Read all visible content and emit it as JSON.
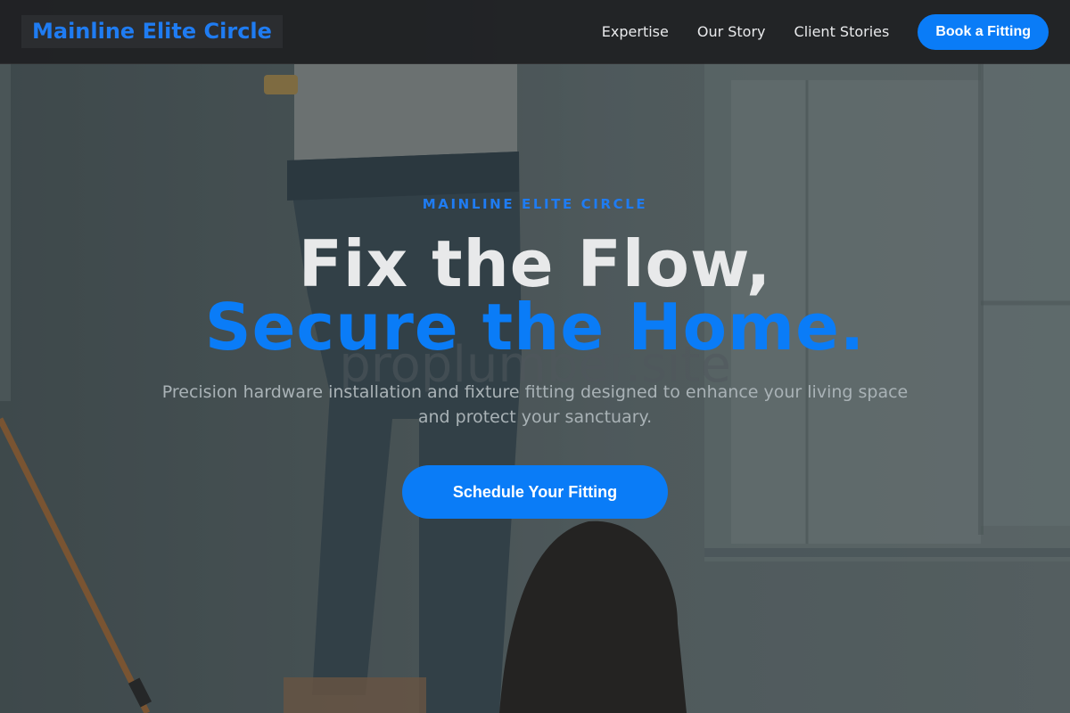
{
  "nav": {
    "brand": "Mainline Elite Circle",
    "links": [
      "Expertise",
      "Our Story",
      "Client Stories"
    ],
    "cta": "Book a Fitting"
  },
  "hero": {
    "eyebrow": "MAINLINE ELITE CIRCLE",
    "headline_line1": "Fix the Flow,",
    "headline_line2": "Secure the Home.",
    "watermark": "proplumber.site",
    "subtext": "Precision hardware installation and fixture fitting designed to enhance your living space and protect your sanctuary.",
    "cta": "Schedule Your Fitting",
    "background_image": "person-on-stepladder-with-paint-roller-and-child"
  },
  "colors": {
    "accent": "#0a7cf7",
    "nav_bg": "#1e2022",
    "text_light": "#e8e9ea",
    "text_muted": "#a9b2b6"
  }
}
